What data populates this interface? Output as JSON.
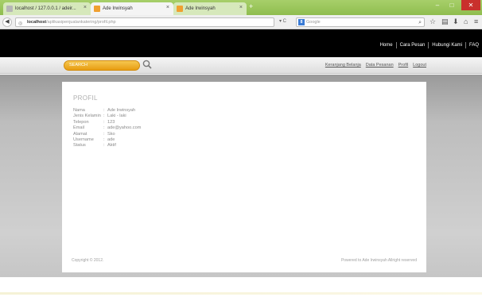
{
  "browser": {
    "tabs": [
      {
        "title": "localhost / 127.0.0.1 / adeir...",
        "active": false
      },
      {
        "title": "Ade Irwinsyah",
        "active": true
      },
      {
        "title": "Ade Irwinsyah",
        "active": false
      }
    ],
    "new_tab": "+",
    "url_host": "localhost",
    "url_path": "/aplikasipenjualankatering/profil.php",
    "search_placeholder": "Google",
    "window_controls": {
      "minimize": "–",
      "maximize": "□",
      "close": "✕"
    }
  },
  "header": {
    "nav": [
      "Home",
      "Cara Pesan",
      "Hubungi Kami",
      "FAQ"
    ]
  },
  "search": {
    "placeholder": "SEARCH"
  },
  "sublinks": [
    "Keranjang Belanja",
    "Data Pesanan",
    "Profil",
    "Logout"
  ],
  "profile": {
    "title": "PROFIL",
    "fields": [
      {
        "label": "Nama",
        "value": "Ade Irwinsyah"
      },
      {
        "label": "Jenis Kelamin",
        "value": "Laki - laki"
      },
      {
        "label": "Telepon",
        "value": "123"
      },
      {
        "label": "Email",
        "value": "ade@yahoo.com"
      },
      {
        "label": "Alamat",
        "value": "Sko"
      },
      {
        "label": "Username",
        "value": "ade"
      },
      {
        "label": "Status",
        "value": "Aktif"
      }
    ]
  },
  "footer": {
    "copyright": "Copyright © 2012.",
    "powered": "Powered to Ade Irwinsyah Allright reserved"
  },
  "colors": {
    "tabbar": "#9bc75a",
    "header": "#000000",
    "search_pill": "#f0b02c",
    "close_button": "#c9302c"
  }
}
